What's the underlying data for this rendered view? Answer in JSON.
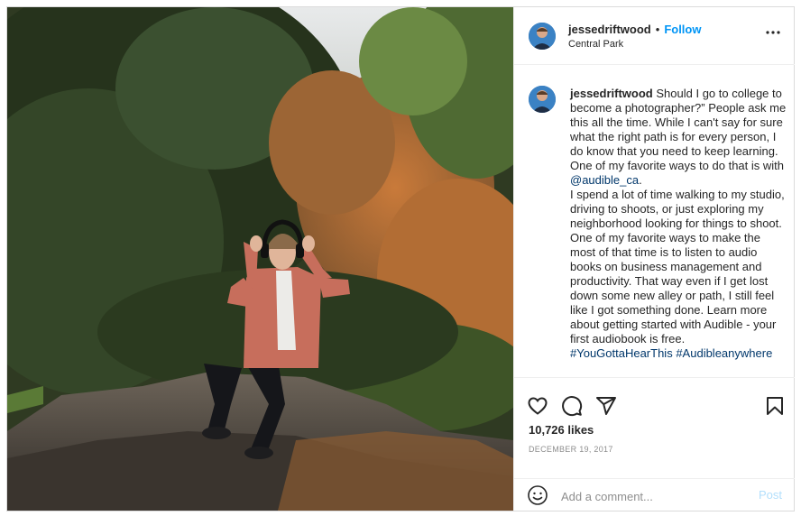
{
  "post": {
    "username": "jessedriftwood",
    "follow_label": "Follow",
    "separator": "•",
    "location": "Central Park",
    "more_label": "•••"
  },
  "caption": {
    "username": "jessedriftwood",
    "text1": "Should I go to college to become a photographer?” People ask me this all the time. While I can't say for sure what the right path is for every person, I do know that you need to keep learning. One of my favorite ways to do that is with ",
    "mention": "@audible_ca",
    "text1_end": ".",
    "text2": "I spend a lot of time walking to my studio, driving to shoots, or just exploring my neighborhood looking for things to shoot. One of my favorite ways to make the most of that time is to listen to audio books on business management and productivity. That way even if I get lost down some new alley or path, I still feel like I got something done. Learn more about getting started with Audible - your first audiobook is free.",
    "hashtag1": "#YouGottaHearThis",
    "hashtag2": "#Audibleanywhere"
  },
  "actions": {
    "icons": [
      "heart-icon",
      "comment-icon",
      "share-icon",
      "bookmark-icon"
    ],
    "likes": "10,726 likes",
    "date": "DECEMBER 19, 2017"
  },
  "comment_box": {
    "placeholder": "Add a comment...",
    "post_label": "Post"
  },
  "colors": {
    "link": "#0095f6",
    "mention": "#00376b",
    "post_disabled": "#b2dffc"
  }
}
